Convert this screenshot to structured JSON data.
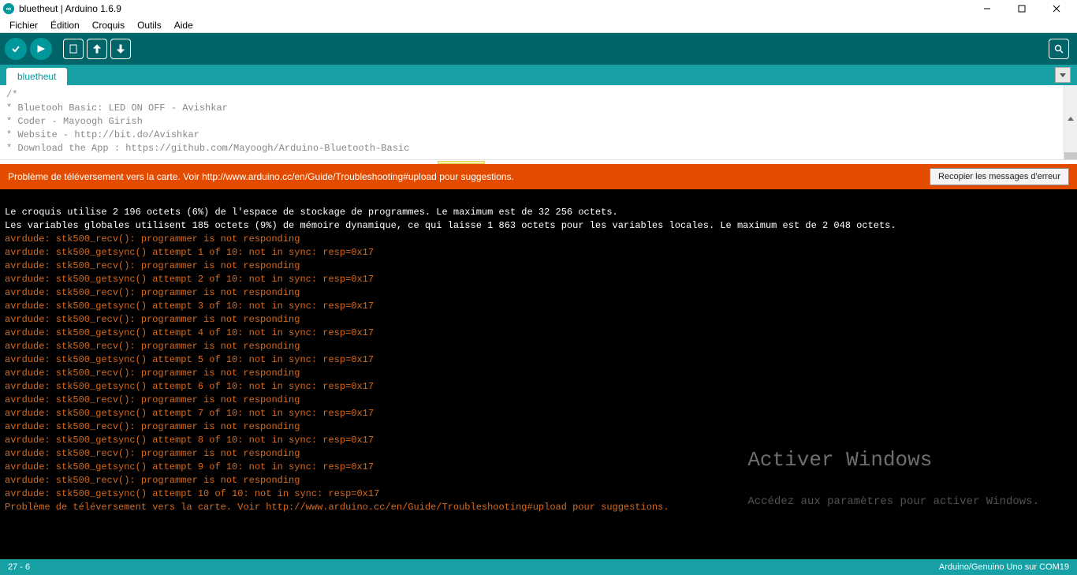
{
  "window": {
    "title": "bluetheut | Arduino 1.6.9"
  },
  "menu": {
    "items": [
      "Fichier",
      "Édition",
      "Croquis",
      "Outils",
      "Aide"
    ]
  },
  "tab": {
    "label": "bluetheut"
  },
  "code": {
    "l1": "/*",
    "l2": "* Bluetooh Basic: LED ON OFF - Avishkar",
    "l3": "* Coder - Mayoogh Girish",
    "l4_pre": "* Website - ",
    "l4_link": "http://bit.do/Avishkar",
    "l5_pre": "* Download the App : ",
    "l5_link": "https://github.com/Mayoogh/Arduino-Bluetooth-Basic"
  },
  "errorbar": {
    "msg": "Problème de téléversement vers la carte. Voir http://www.arduino.cc/en/Guide/Troubleshooting#upload pour suggestions.",
    "button": "Recopier les messages d'erreur"
  },
  "console": {
    "blank": " ",
    "w1": "Le croquis utilise 2 196 octets (6%) de l'espace de stockage de programmes. Le maximum est de 32 256 octets.",
    "w2": "Les variables globales utilisent 185 octets (9%) de mémoire dynamique, ce qui laisse 1 863 octets pour les variables locales. Le maximum est de 2 048 octets.",
    "recv": "avrdude: stk500_recv(): programmer is not responding",
    "s1": "avrdude: stk500_getsync() attempt 1 of 10: not in sync: resp=0x17",
    "s2": "avrdude: stk500_getsync() attempt 2 of 10: not in sync: resp=0x17",
    "s3": "avrdude: stk500_getsync() attempt 3 of 10: not in sync: resp=0x17",
    "s4": "avrdude: stk500_getsync() attempt 4 of 10: not in sync: resp=0x17",
    "s5": "avrdude: stk500_getsync() attempt 5 of 10: not in sync: resp=0x17",
    "s6": "avrdude: stk500_getsync() attempt 6 of 10: not in sync: resp=0x17",
    "s7": "avrdude: stk500_getsync() attempt 7 of 10: not in sync: resp=0x17",
    "s8": "avrdude: stk500_getsync() attempt 8 of 10: not in sync: resp=0x17",
    "s9": "avrdude: stk500_getsync() attempt 9 of 10: not in sync: resp=0x17",
    "s10": "avrdude: stk500_getsync() attempt 10 of 10: not in sync: resp=0x17",
    "final": "Problème de téléversement vers la carte. Voir http://www.arduino.cc/en/Guide/Troubleshooting#upload pour suggestions."
  },
  "watermark": {
    "line1": "Activer Windows",
    "line2": "Accédez aux paramètres pour activer Windows."
  },
  "status": {
    "pos": "27 - 6",
    "board": "Arduino/Genuino Uno sur COM19"
  }
}
